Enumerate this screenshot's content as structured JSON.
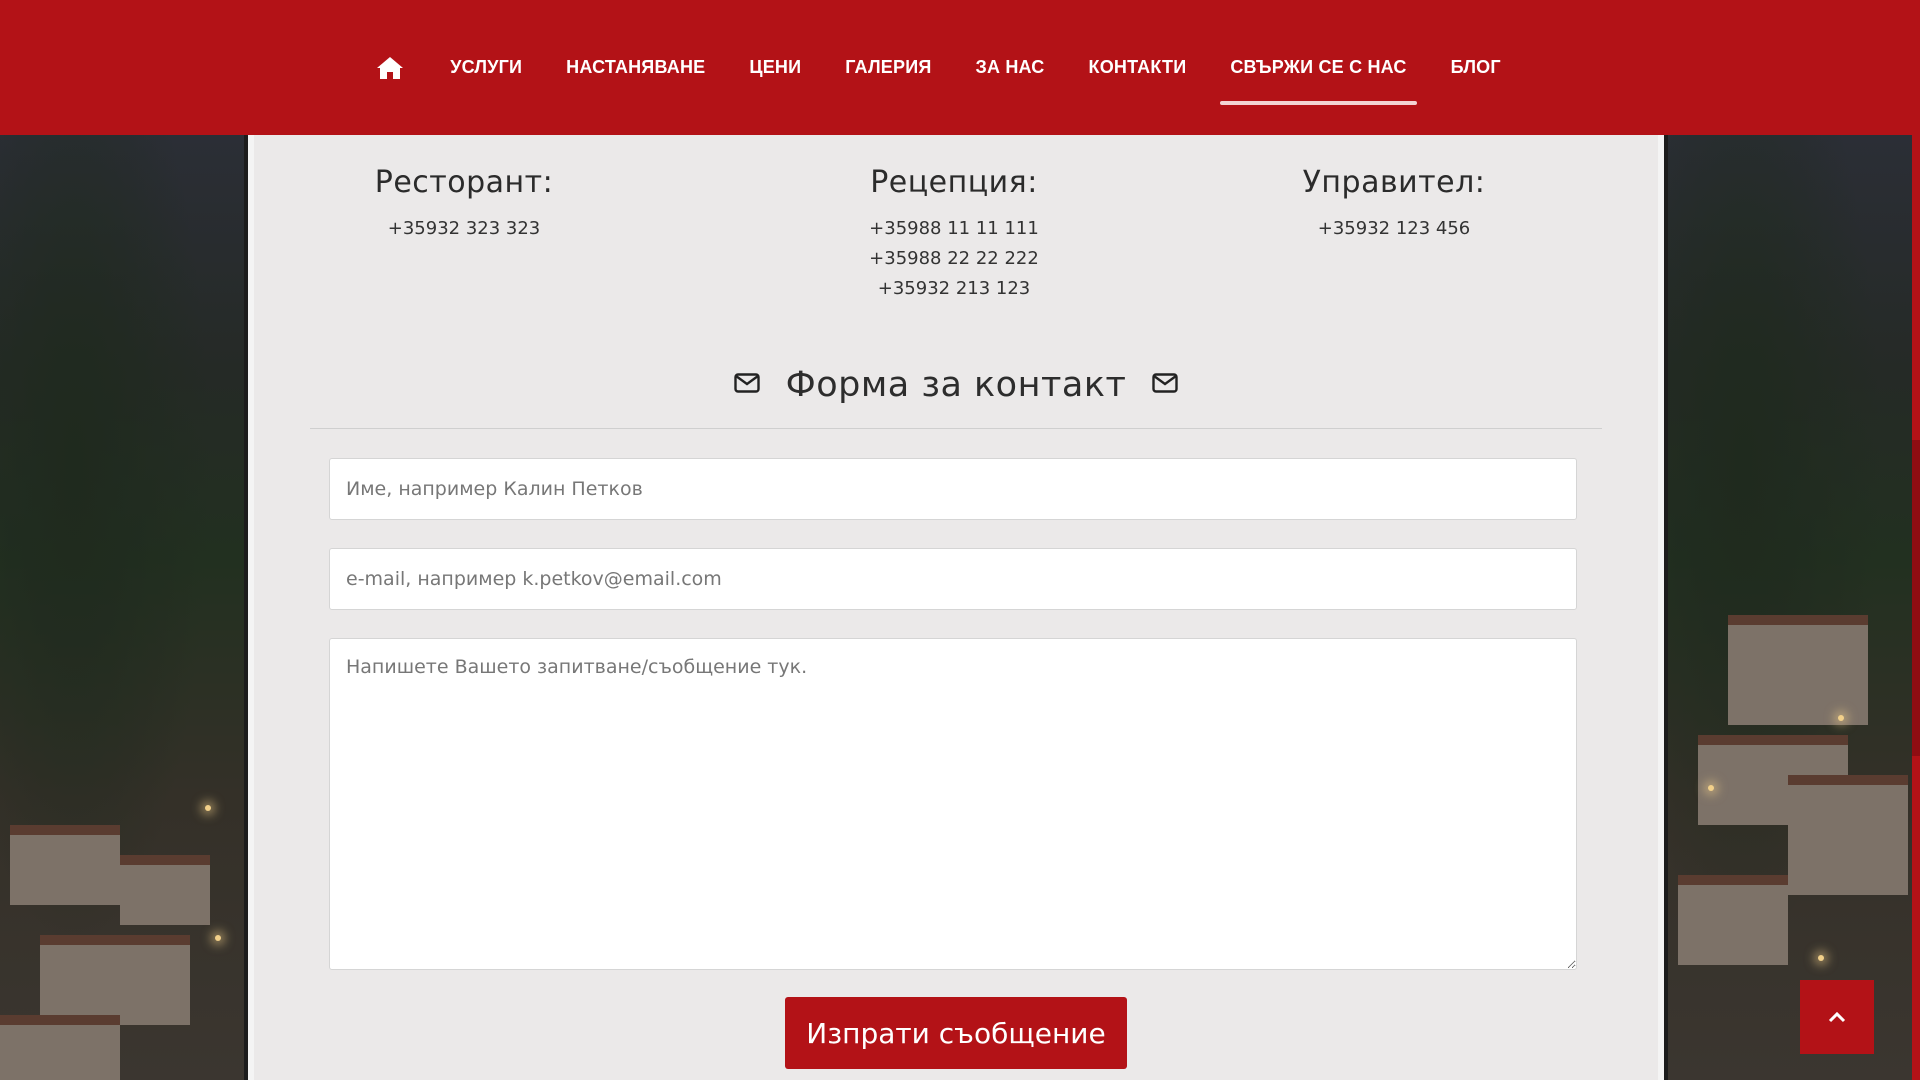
{
  "nav": {
    "home_icon": "home-icon",
    "items": [
      {
        "label": "УСЛУГИ"
      },
      {
        "label": "НАСТАНЯВАНЕ"
      },
      {
        "label": "ЦЕНИ"
      },
      {
        "label": "ГАЛЕРИЯ"
      },
      {
        "label": "ЗА НАС"
      },
      {
        "label": "КОНТАКТИ"
      },
      {
        "label": "СВЪРЖИ СЕ С НАС",
        "active": true
      },
      {
        "label": "БЛОГ"
      }
    ]
  },
  "contacts": {
    "restaurant": {
      "title": "Ресторант:",
      "phones": [
        "+35932 323 323"
      ]
    },
    "reception": {
      "title": "Рецепция:",
      "phones": [
        "+35988 11 11 111",
        "+35988 22 22 222",
        "+35932 213 123"
      ]
    },
    "manager": {
      "title": "Управител:",
      "phones": [
        "+35932 123 456"
      ]
    }
  },
  "form": {
    "title": "Форма за контакт",
    "title_icon": "envelope-icon",
    "name_placeholder": "Име, например Калин Петков",
    "email_placeholder": "e-mail, например k.petkov@email.com",
    "message_placeholder": "Напишете Вашето запитване/съобщение тук.",
    "submit_label": "Изпрати съобщение"
  },
  "back_to_top_icon": "chevron-up-icon",
  "colors": {
    "brand": "#b31217",
    "text": "#2b2b2b",
    "panel": "#eae8e8"
  }
}
